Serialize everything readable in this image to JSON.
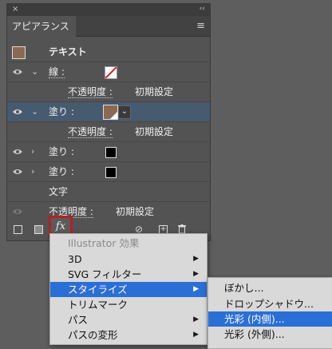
{
  "panel": {
    "close_icon": "×",
    "collapse_icon": "‹‹",
    "tab_label": "アピアランス",
    "menu_icon": "≡",
    "object_label": "テキスト",
    "object_swatch_color": "#8b6a53",
    "rows": [
      {
        "label": "線 :",
        "kind": "stroke"
      },
      {
        "label": "不透明度 :",
        "value": "初期設定",
        "kind": "opacity"
      },
      {
        "label": "塗り :",
        "kind": "fill-brown"
      },
      {
        "label": "不透明度 :",
        "value": "初期設定",
        "kind": "opacity"
      },
      {
        "label": "塗り :",
        "kind": "fill-black"
      },
      {
        "label": "塗り :",
        "kind": "fill-black"
      },
      {
        "label": "文字",
        "kind": "chars"
      },
      {
        "label": "不透明度 :",
        "value": "初期設定",
        "kind": "opacity"
      }
    ],
    "fx_label": "fx",
    "selected_fill_color": "#8b6a53",
    "selection_color": "#465a70"
  },
  "menu": {
    "header": "Illustrator 効果",
    "items": [
      {
        "label": "3D",
        "submenu": true
      },
      {
        "label": "SVG フィルター",
        "submenu": true
      },
      {
        "label": "スタイライズ",
        "submenu": true
      },
      {
        "label": "トリムマーク",
        "submenu": false
      },
      {
        "label": "パス",
        "submenu": true
      },
      {
        "label": "パスの変形",
        "submenu": true
      }
    ],
    "highlight_color": "#2a6fd6"
  },
  "submenu": {
    "items": [
      {
        "label": "ぼかし..."
      },
      {
        "label": "ドロップシャドウ..."
      },
      {
        "label": "光彩 (内側)..."
      },
      {
        "label": "光彩 (外側)..."
      }
    ]
  }
}
